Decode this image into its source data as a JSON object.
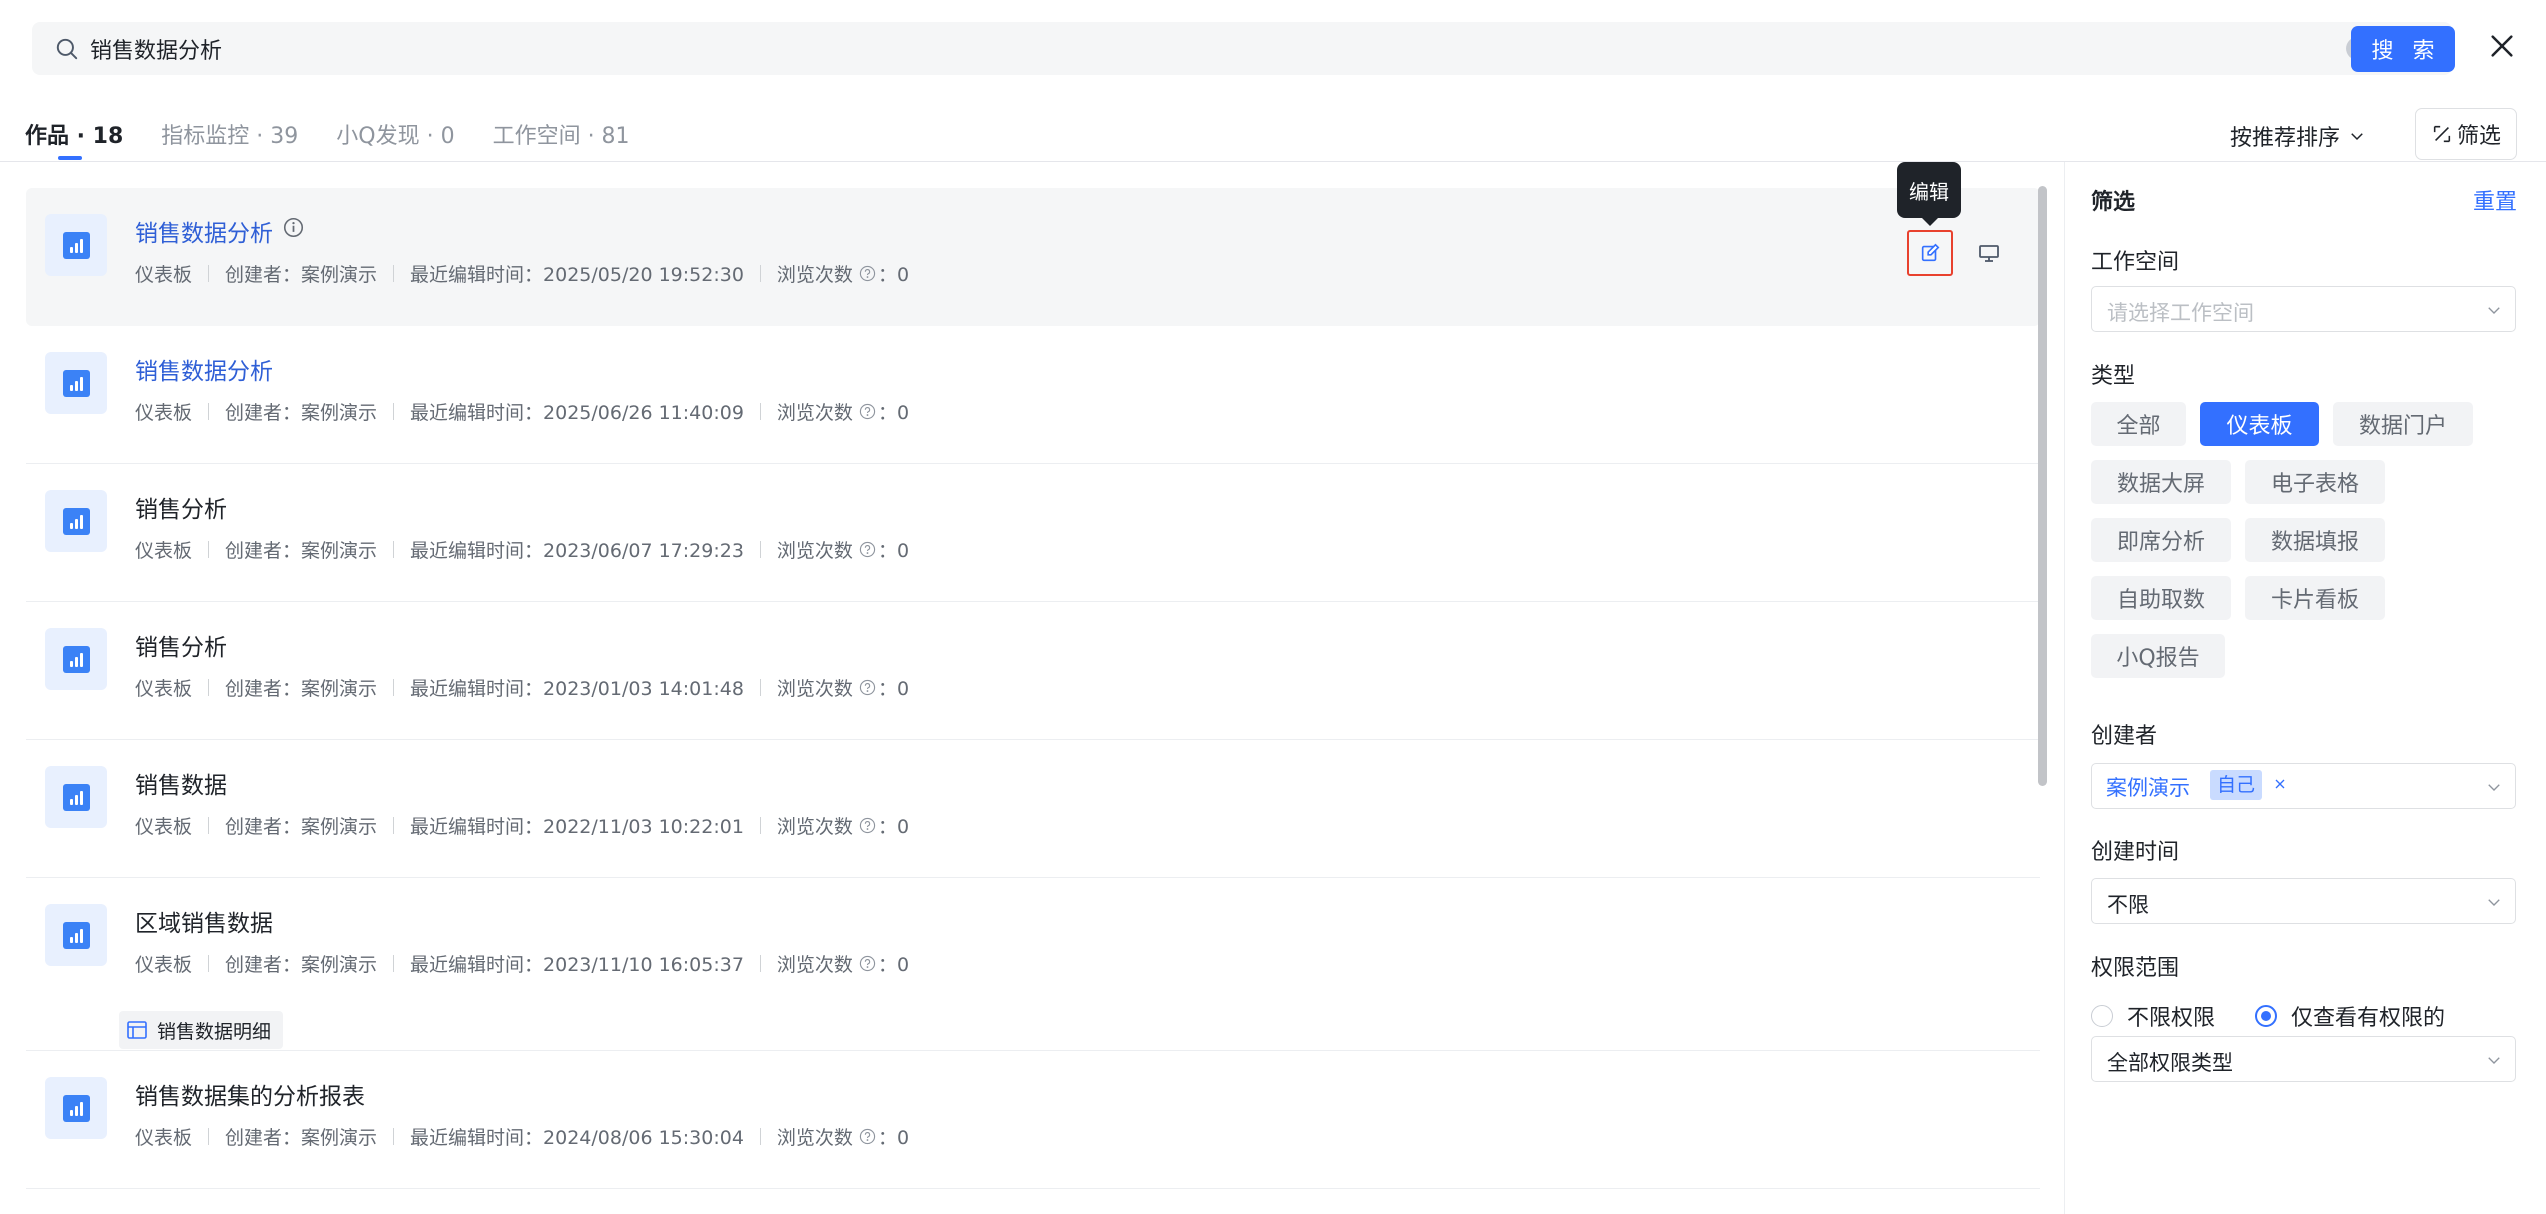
{
  "search": {
    "value": "销售数据分析",
    "button_label": "搜 索"
  },
  "tabs": [
    {
      "label": "作品 · 18"
    },
    {
      "label": "指标监控 · 39"
    },
    {
      "label": "小Q发现 · 0"
    },
    {
      "label": "工作空间 · 81"
    }
  ],
  "sort": {
    "label": "按推荐排序"
  },
  "filter_button": {
    "label": "筛选"
  },
  "results": [
    {
      "title": "销售数据分析",
      "type": "仪表板",
      "creator": "创建者：案例演示",
      "edited": "最近编辑时间：2025/05/20 19:52:30",
      "views_label": "浏览次数",
      "views": "：0"
    },
    {
      "title": "销售数据分析",
      "type": "仪表板",
      "creator": "创建者：案例演示",
      "edited": "最近编辑时间：2025/06/26 11:40:09",
      "views_label": "浏览次数",
      "views": "：0"
    },
    {
      "title": "销售分析",
      "type": "仪表板",
      "creator": "创建者：案例演示",
      "edited": "最近编辑时间：2023/06/07 17:29:23",
      "views_label": "浏览次数",
      "views": "：0"
    },
    {
      "title": "销售分析",
      "type": "仪表板",
      "creator": "创建者：案例演示",
      "edited": "最近编辑时间：2023/01/03 14:01:48",
      "views_label": "浏览次数",
      "views": "：0"
    },
    {
      "title": "销售数据",
      "type": "仪表板",
      "creator": "创建者：案例演示",
      "edited": "最近编辑时间：2022/11/03 10:22:01",
      "views_label": "浏览次数",
      "views": "：0"
    },
    {
      "title": "区域销售数据",
      "type": "仪表板",
      "creator": "创建者：案例演示",
      "edited": "最近编辑时间：2023/11/10 16:05:37",
      "views_label": "浏览次数",
      "views": "：0",
      "dataset": "销售数据明细"
    },
    {
      "title": "销售数据集的分析报表",
      "type": "仪表板",
      "creator": "创建者：案例演示",
      "edited": "最近编辑时间：2024/08/06 15:30:04",
      "views_label": "浏览次数",
      "views": "：0"
    }
  ],
  "tooltip": {
    "edit": "编辑"
  },
  "panel": {
    "title": "筛选",
    "reset": "重置",
    "workspace": {
      "label": "工作空间",
      "placeholder": "请选择工作空间"
    },
    "type": {
      "label": "类型",
      "options": [
        "全部",
        "仪表板",
        "数据门户",
        "数据大屏",
        "电子表格",
        "即席分析",
        "数据填报",
        "自助取数",
        "卡片看板",
        "小Q报告"
      ],
      "selected": "仪表板"
    },
    "creator": {
      "label": "创建者",
      "value": "案例演示",
      "tag": "自己"
    },
    "created_time": {
      "label": "创建时间",
      "value": "不限"
    },
    "permission": {
      "label": "权限范围",
      "options": [
        "不限权限",
        "仅查看有权限的"
      ],
      "selected": "仅查看有权限的",
      "type_value": "全部权限类型"
    }
  },
  "colors": {
    "accent": "#3370ff",
    "link": "#2f5fd6",
    "highlight_border": "#e8412e"
  }
}
